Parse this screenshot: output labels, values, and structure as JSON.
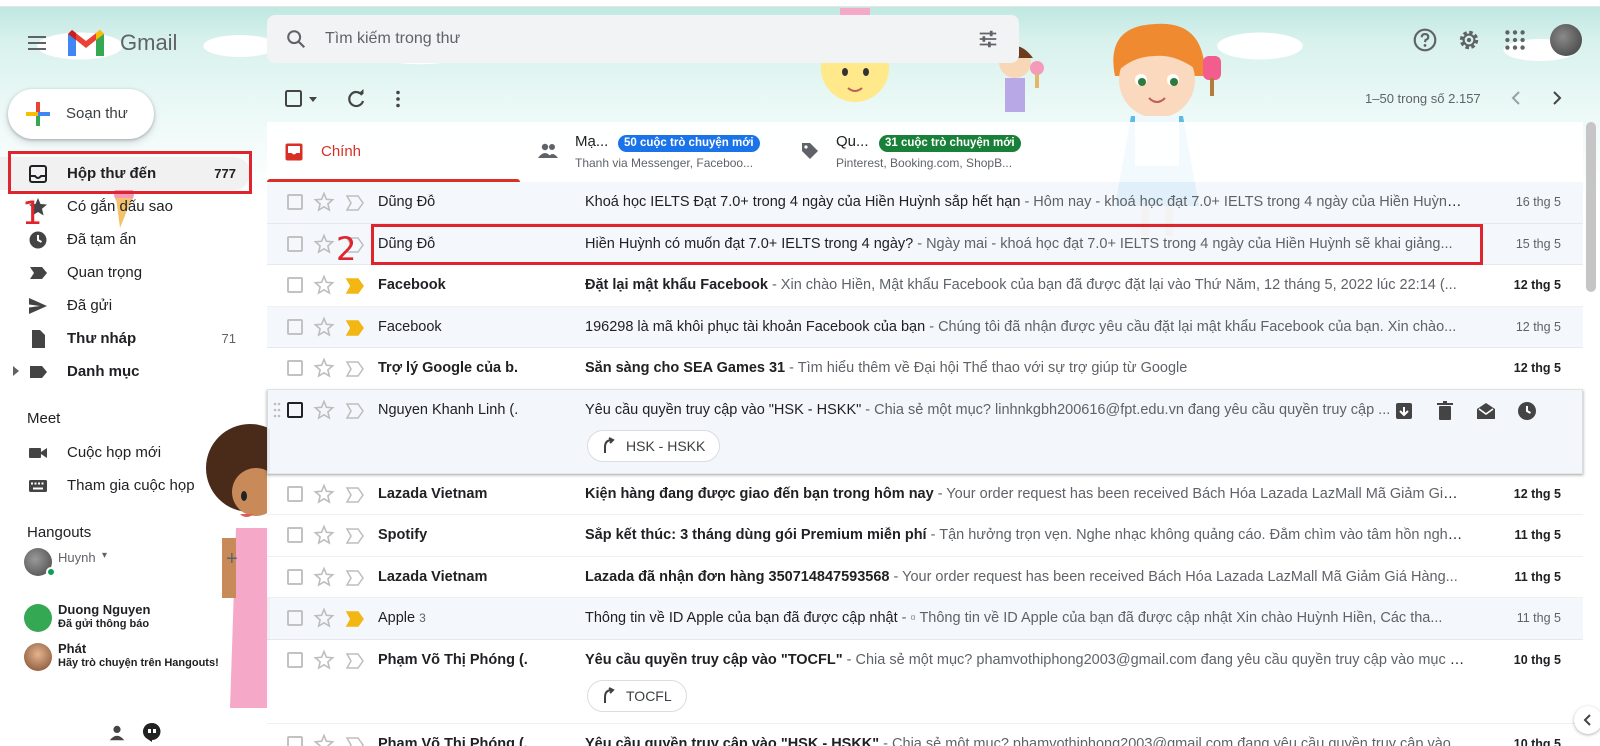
{
  "header": {
    "app_name": "Gmail",
    "search_placeholder": "Tìm kiếm trong thư"
  },
  "sidebar": {
    "compose_label": "Soạn thư",
    "items": [
      {
        "label": "Hộp thư đến",
        "count": "777"
      },
      {
        "label": "Có gắn dấu sao",
        "count": ""
      },
      {
        "label": "Đã tạm ẩn",
        "count": ""
      },
      {
        "label": "Quan trọng",
        "count": ""
      },
      {
        "label": "Đã gửi",
        "count": ""
      },
      {
        "label": "Thư nháp",
        "count": "71"
      },
      {
        "label": "Danh mục",
        "count": ""
      }
    ],
    "meet": {
      "title": "Meet",
      "items": [
        {
          "label": "Cuộc họp mới"
        },
        {
          "label": "Tham gia cuộc họp"
        }
      ]
    },
    "hangouts": {
      "title": "Hangouts",
      "self_name": "Huynh",
      "self_chevron": "▾",
      "add_label": "+",
      "contacts": [
        {
          "name": "Duong Nguyen",
          "status": "Đã gửi thông báo"
        },
        {
          "name": "Phát",
          "status": "Hãy trò chuyện trên Hangouts!"
        }
      ]
    }
  },
  "toolbar": {
    "pager_text": "1–50 trong số 2.157"
  },
  "tabs": [
    {
      "name": "Chính",
      "badge": "",
      "sub": "",
      "color": "#d93025"
    },
    {
      "name": "Mạ...",
      "badge": "50 cuộc trò chuyện mới",
      "sub": "Thanh via Messenger, Faceboo...",
      "color": "#1a73e8"
    },
    {
      "name": "Qu...",
      "badge": "31 cuộc trò chuyện mới",
      "sub": "Pinterest, Booking.com, ShopB...",
      "color": "#188038"
    }
  ],
  "emails": [
    {
      "sender": "Dũng Đỗ",
      "sender_count": "",
      "subject": "Khoá học IELTS Đạt 7.0+ trong 4 ngày của Hiền Huỳnh sắp hết hạn",
      "snippet": " - Hôm nay - khoá học đạt 7.0+ IELTS trong 4 ngày của Hiền Huỳnh sẽ kết thúc...",
      "date": "16 thg 5",
      "unread": false,
      "important": false,
      "chip": ""
    },
    {
      "sender": "Dũng Đỗ",
      "sender_count": "",
      "subject": "Hiền Huỳnh có muốn đạt 7.0+ IELTS trong 4 ngày?",
      "snippet": " - Ngày mai - khoá học đạt 7.0+ IELTS trong 4 ngày của Hiền Huỳnh sẽ khai giảng...",
      "date": "15 thg 5",
      "unread": false,
      "important": false,
      "chip": ""
    },
    {
      "sender": "Facebook",
      "sender_count": "",
      "subject": "Đặt lại mật khẩu Facebook",
      "snippet": " - Xin chào Hiền, Mật khẩu Facebook của bạn đã được đặt lại vào Thứ Năm, 12 tháng 5, 2022 lúc 22:14 (...",
      "date": "12 thg 5",
      "unread": true,
      "important": true,
      "chip": ""
    },
    {
      "sender": "Facebook",
      "sender_count": "",
      "subject": "196298 là mã khôi phục tài khoản Facebook của bạn",
      "snippet": " - Chúng tôi đã nhận được yêu cầu đặt lại mật khẩu Facebook của bạn. Xin chào...",
      "date": "12 thg 5",
      "unread": false,
      "important": true,
      "chip": ""
    },
    {
      "sender": "Trợ lý Google của b.",
      "sender_count": "",
      "subject": "Sẵn sàng cho SEA Games 31",
      "snippet": " - Tìm hiểu thêm về Đại hội Thể thao với sự trợ giúp từ Google",
      "date": "12 thg 5",
      "unread": true,
      "important": false,
      "chip": ""
    },
    {
      "sender": "Nguyen Khanh Linh (.",
      "sender_count": "",
      "subject": "Yêu cầu quyền truy cập vào \"HSK - HSKK\"",
      "snippet": " - Chia sẻ một mục? linhnkgbh200616@fpt.edu.vn đang yêu cầu quyền truy cập ...",
      "date": "",
      "unread": false,
      "important": false,
      "chip": "HSK - HSKK",
      "hovered": true
    },
    {
      "sender": "Lazada Vietnam",
      "sender_count": "",
      "subject": "Kiện hàng đang được giao đến bạn trong hôm nay",
      "snippet": " - Your order request has been received Bách Hóa Lazada LazMall Mã Giảm Giá ...",
      "date": "12 thg 5",
      "unread": true,
      "important": false,
      "chip": ""
    },
    {
      "sender": "Spotify",
      "sender_count": "",
      "subject": "Sắp kết thúc: 3 tháng dùng gói Premium miễn phí",
      "snippet": " - Tận hưởng trọn vẹn. Nghe nhạc không quảng cáo. Đắm chìm vào tâm hồn nghệ...",
      "date": "11 thg 5",
      "unread": true,
      "important": false,
      "chip": ""
    },
    {
      "sender": "Lazada Vietnam",
      "sender_count": "",
      "subject": "Lazada đã nhận đơn hàng 350714847593568",
      "snippet": " - Your order request has been received Bách Hóa Lazada LazMall Mã Giảm Giá Hàng...",
      "date": "11 thg 5",
      "unread": true,
      "important": false,
      "chip": ""
    },
    {
      "sender": "Apple",
      "sender_count": "3",
      "subject": "Thông tin về ID Apple của bạn đã được cập nhật",
      "snippet": " - ▫ Thông tin về ID Apple của bạn đã được cập nhật Xin chào Huỳnh Hiền, Các tha...",
      "date": "11 thg 5",
      "unread": false,
      "important": true,
      "chip": ""
    },
    {
      "sender": "Phạm Võ Thị Phóng (.",
      "sender_count": "",
      "subject": "Yêu cầu quyền truy cập vào \"TOCFL\"",
      "snippet": " - Chia sẻ một mục? phamvothiphong2003@gmail.com đang yêu cầu quyền truy cập vào mục s...",
      "date": "10 thg 5",
      "unread": true,
      "important": false,
      "chip": "TOCFL"
    },
    {
      "sender": "Phạm Võ Thị Phóng (.",
      "sender_count": "",
      "subject": "Yêu cầu quyền truy cập vào \"HSK - HSKK\"",
      "snippet": " - Chia sẻ một mục? phamvothiphong2003@gmail.com đang yêu cầu quyền truy cập vào...",
      "date": "10 thg 5",
      "unread": true,
      "important": false,
      "chip": ""
    }
  ],
  "annotations": [
    {
      "number": "1"
    },
    {
      "number": "2"
    }
  ],
  "colors": {
    "accent_red": "#d93025",
    "annotation_red": "#e0242e",
    "important_yellow": "#f2b713",
    "badge_blue": "#1a73e8",
    "badge_green": "#188038"
  }
}
